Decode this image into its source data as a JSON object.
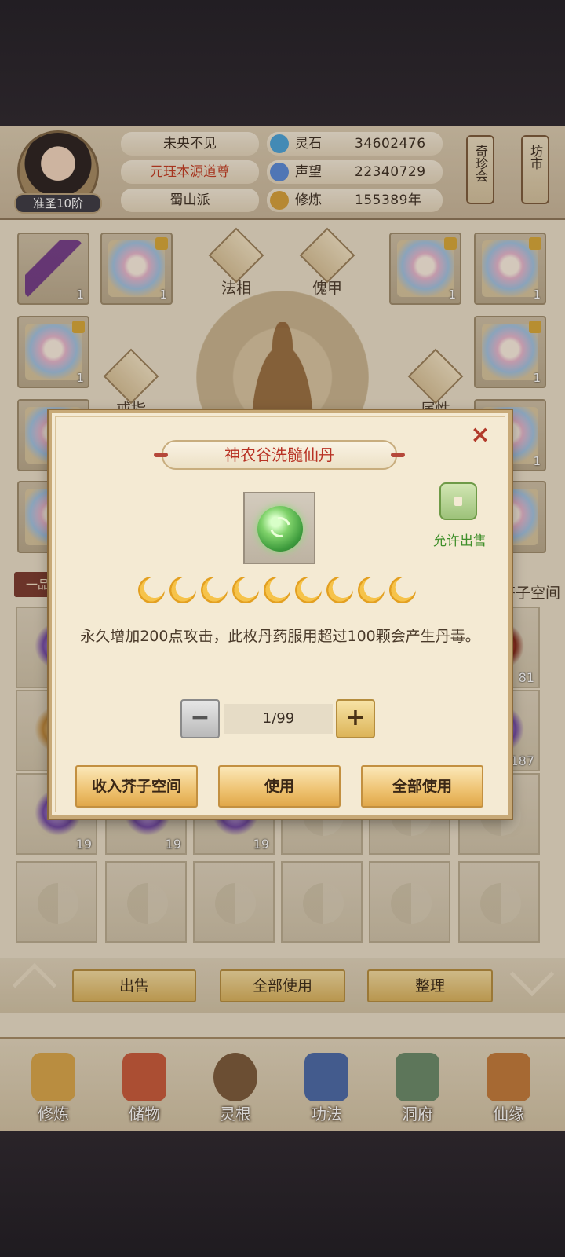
{
  "player": {
    "name": "未央不见",
    "title": "元珏本源道尊",
    "sect": "蜀山派",
    "rank": "准圣10阶"
  },
  "stats": [
    {
      "label": "灵石",
      "value": "34602476",
      "icon": "spirit-stone-icon",
      "color": "#4aa3d8"
    },
    {
      "label": "声望",
      "value": "22340729",
      "icon": "prestige-crystal-icon",
      "color": "#5a8ad8"
    },
    {
      "label": "修炼",
      "value": "155389年",
      "icon": "meditation-icon",
      "color": "#d6a03a"
    }
  ],
  "side_buttons": {
    "treasure_fair": "奇珍会",
    "market": "坊市"
  },
  "equip_tabs": {
    "dharma": "法相",
    "armor": "傀甲",
    "ring": "戒指",
    "attributes": "属性"
  },
  "equip_slots": [
    {
      "count": "1",
      "kind": "sword"
    },
    {
      "count": "1",
      "kind": "locked"
    },
    {
      "count": "1",
      "kind": "locked"
    },
    {
      "count": "1",
      "kind": "locked"
    },
    {
      "count": "1",
      "kind": "locked"
    },
    {
      "count": "1",
      "kind": "locked"
    },
    {
      "count": "1",
      "kind": "locked"
    },
    {
      "count": "1",
      "kind": "locked"
    }
  ],
  "inventory": {
    "category_tab": "一品",
    "mustard_space_tab": "芥子空间",
    "counts": [
      "81",
      "187",
      "19",
      "19",
      "19"
    ]
  },
  "bottom_actions": {
    "sell": "出售",
    "use_all": "全部使用",
    "sort": "整理"
  },
  "nav": [
    {
      "label": "修炼",
      "icon": "cultivation-monk-icon",
      "color": "#d9a64a"
    },
    {
      "label": "储物",
      "icon": "storage-bag-icon",
      "color": "#c95a3a"
    },
    {
      "label": "灵根",
      "icon": "spirit-root-icon",
      "color": "#7a5a3a"
    },
    {
      "label": "功法",
      "icon": "technique-book-icon",
      "color": "#4a6aa8"
    },
    {
      "label": "洞府",
      "icon": "cave-dwelling-icon",
      "color": "#6a8a6a"
    },
    {
      "label": "仙缘",
      "icon": "immortal-fate-icon",
      "color": "#c27a3a"
    }
  ],
  "dialog": {
    "title": "神农谷洗髓仙丹",
    "allow_sale": "允许出售",
    "stars": 9,
    "description": "永久增加200点攻击，此枚丹药服用超过100颗会产生丹毒。",
    "quantity": "1/99",
    "minus_label": "−",
    "plus_label": "+",
    "btn_store": "收入芥子空间",
    "btn_use": "使用",
    "btn_use_all": "全部使用",
    "close_label": "×"
  }
}
